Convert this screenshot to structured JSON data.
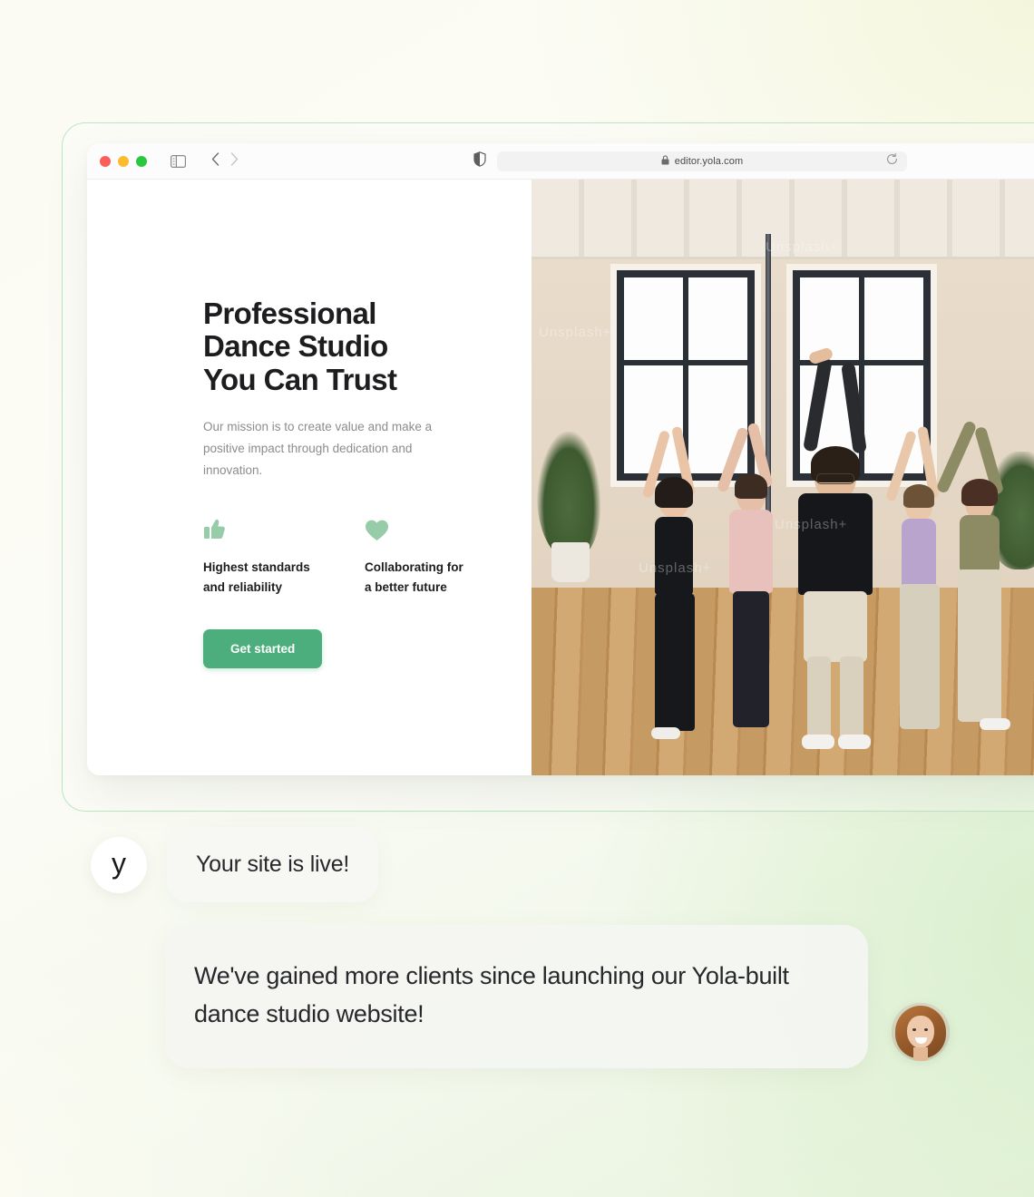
{
  "browser": {
    "traffic_lights": [
      "close",
      "minimize",
      "maximize"
    ],
    "sidebar_icon": "sidebar-toggle-icon",
    "back_icon": "chevron-left-icon",
    "forward_icon": "chevron-right-icon",
    "shield_icon": "shield-icon",
    "lock_icon": "lock-icon",
    "url": "editor.yola.com",
    "reload_icon": "reload-icon"
  },
  "site": {
    "hero": {
      "title": "Professional\nDance Studio\nYou Can Trust",
      "subtitle": "Our mission is to create value and make a positive impact through dedication and innovation.",
      "cta_label": "Get started",
      "features": [
        {
          "icon": "thumbs-up-icon",
          "label": "Highest standards\nand reliability"
        },
        {
          "icon": "heart-icon",
          "label": "Collaborating for\na better future"
        }
      ]
    },
    "photo": {
      "alt": "dance-studio-class-photo",
      "watermarks": [
        "Unsplash+",
        "Unsplash+",
        "Unsplash+",
        "Unsplash+"
      ]
    }
  },
  "chat": {
    "messages": [
      {
        "avatar": "yola-logo-avatar",
        "avatar_mark": "y",
        "text": "Your site is live!"
      },
      {
        "avatar": "client-photo-avatar",
        "text": "We've gained more clients since launching our Yola-built dance studio website!"
      }
    ]
  },
  "colors": {
    "accent_green": "#4CAE7C",
    "icon_green": "#96CCA8",
    "frame_border": "#BFE3C4",
    "text_dark": "#1D1D20",
    "text_muted": "#8C8C8F",
    "bubble_bg": "#F4F5F2"
  }
}
